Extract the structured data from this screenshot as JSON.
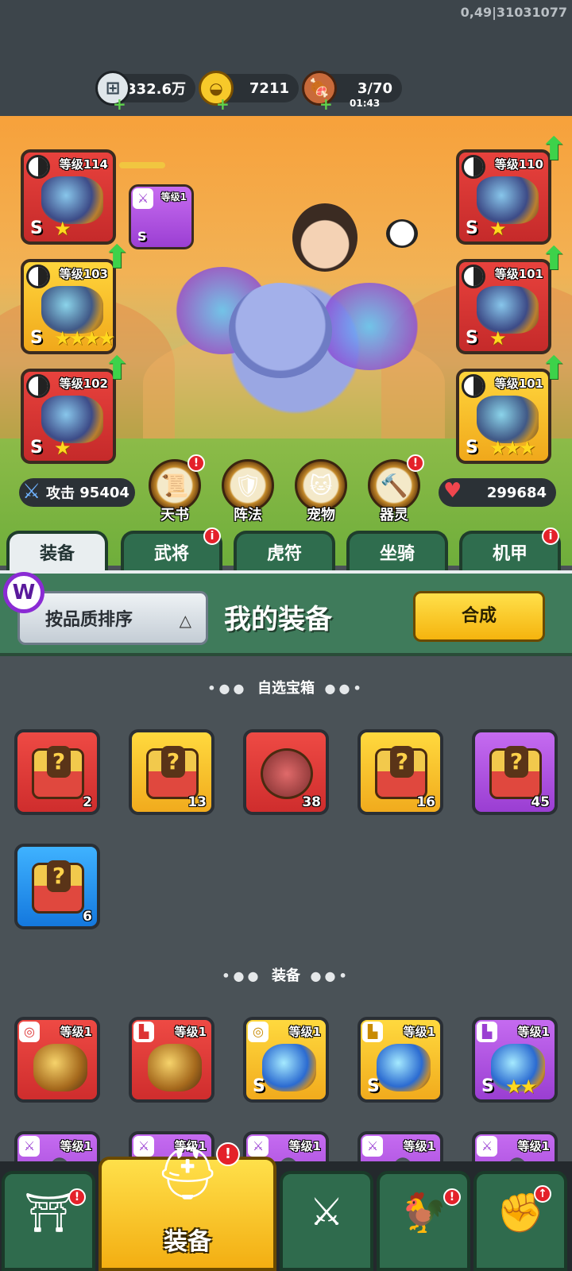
{
  "debug_text": "0,49|31031077",
  "resources": {
    "silver": "332.6万",
    "gold": "7211",
    "stamina": "3/70",
    "stamina_timer": "01:43"
  },
  "hero": {
    "slots_left": [
      {
        "level": "等级114",
        "color": "red",
        "grade": "S",
        "stars": 1,
        "upgrade": false
      },
      {
        "level": "等级103",
        "color": "yellow",
        "grade": "S",
        "stars": 4,
        "upgrade": true
      },
      {
        "level": "等级102",
        "color": "red",
        "grade": "S",
        "stars": 1,
        "upgrade": true
      }
    ],
    "linked_item": {
      "level": "等级1",
      "color": "purple",
      "grade": "S"
    },
    "slots_right": [
      {
        "level": "等级110",
        "color": "red",
        "grade": "S",
        "stars": 1,
        "upgrade": true
      },
      {
        "level": "等级101",
        "color": "red",
        "grade": "S",
        "stars": 1,
        "upgrade": true
      },
      {
        "level": "等级101",
        "color": "yellow",
        "grade": "S",
        "stars": 3,
        "upgrade": true
      }
    ],
    "attack_label": "攻击",
    "attack_value": "95404",
    "hp_value": "299684",
    "functions": [
      {
        "label": "天书",
        "icon": "scroll-icon",
        "badge": "!"
      },
      {
        "label": "阵法",
        "icon": "formation-icon",
        "badge": ""
      },
      {
        "label": "宠物",
        "icon": "cat-pet-icon",
        "badge": ""
      },
      {
        "label": "器灵",
        "icon": "spirit-icon",
        "badge": "!"
      }
    ]
  },
  "tabs": [
    {
      "label": "装备",
      "active": true,
      "badge": ""
    },
    {
      "label": "武将",
      "active": false,
      "badge": "i"
    },
    {
      "label": "虎符",
      "active": false,
      "badge": ""
    },
    {
      "label": "坐骑",
      "active": false,
      "badge": ""
    },
    {
      "label": "机甲",
      "active": false,
      "badge": "i"
    }
  ],
  "panel": {
    "sort_label": "按品质排序",
    "title": "我的装备",
    "synth_label": "合成"
  },
  "chest_section": {
    "title": "自选宝箱",
    "items": [
      {
        "color": "red",
        "count": "2"
      },
      {
        "color": "yellow",
        "count": "13"
      },
      {
        "color": "red",
        "count": "38"
      },
      {
        "color": "yellow",
        "count": "16"
      },
      {
        "color": "purple",
        "count": "45"
      },
      {
        "color": "blue",
        "count": "6"
      }
    ]
  },
  "equip_section": {
    "title": "装备",
    "row1": [
      {
        "color": "red",
        "level": "等级1",
        "grade": "",
        "stars": 0
      },
      {
        "color": "red",
        "level": "等级1",
        "grade": "",
        "stars": 0
      },
      {
        "color": "yellow",
        "level": "等级1",
        "grade": "S",
        "stars": 0
      },
      {
        "color": "yellow",
        "level": "等级1",
        "grade": "S",
        "stars": 0
      },
      {
        "color": "purple",
        "level": "等级1",
        "grade": "S",
        "stars": 2
      }
    ],
    "row2": [
      {
        "color": "purple",
        "level": "等级1"
      },
      {
        "color": "purple",
        "level": "等级1"
      },
      {
        "color": "purple",
        "level": "等级1"
      },
      {
        "color": "purple",
        "level": "等级1"
      },
      {
        "color": "purple",
        "level": "等级1"
      }
    ]
  },
  "bottom_nav": [
    {
      "icon": "shop-icon",
      "label": "",
      "badge": "!"
    },
    {
      "icon": "helmet-icon",
      "label": "装备",
      "badge": "!",
      "active": true
    },
    {
      "icon": "battle-icon",
      "label": "",
      "badge": ""
    },
    {
      "icon": "rooster-icon",
      "label": "",
      "badge": "!"
    },
    {
      "icon": "fist-upgrade-icon",
      "label": "",
      "badge": "↑"
    }
  ]
}
